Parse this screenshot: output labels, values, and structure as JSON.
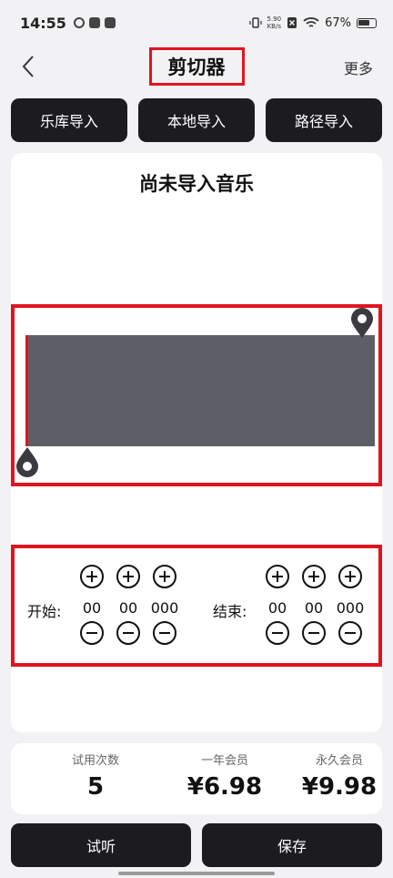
{
  "status_bar": {
    "time": "14:55",
    "speed_top": "5.90",
    "speed_unit": "KB/s",
    "battery": "67%"
  },
  "nav": {
    "title": "剪切器",
    "more": "更多"
  },
  "import_buttons": [
    "乐库导入",
    "本地导入",
    "路径导入"
  ],
  "music": {
    "title": "尚未导入音乐"
  },
  "time_range": {
    "start_label": "开始:",
    "end_label": "结束:",
    "start": {
      "minutes": "00",
      "seconds": "00",
      "millis": "000"
    },
    "end": {
      "minutes": "00",
      "seconds": "00",
      "millis": "000"
    }
  },
  "plans": [
    {
      "label": "试用次数",
      "value": "5"
    },
    {
      "label": "一年会员",
      "value": "¥6.98"
    },
    {
      "label": "永久会员",
      "value": "¥9.98"
    }
  ],
  "actions": {
    "preview": "试听",
    "save": "保存"
  },
  "colors": {
    "accent_red": "#e0141e",
    "dark_button": "#1c1c20",
    "waveform": "#5e5e66"
  }
}
